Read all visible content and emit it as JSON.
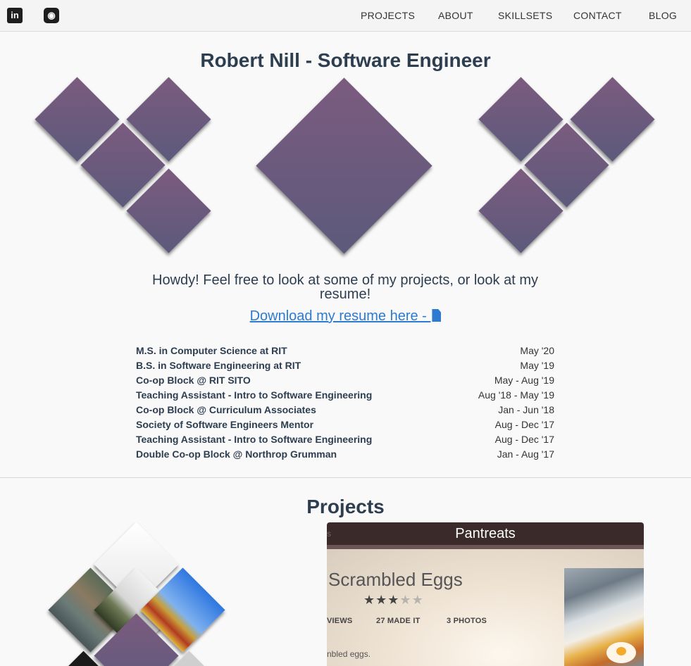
{
  "nav": {
    "social": [
      {
        "name": "linkedin",
        "glyph": "in"
      },
      {
        "name": "github",
        "glyph": "◉"
      }
    ],
    "links": [
      "PROJECTS",
      "ABOUT",
      "SKILLSETS",
      "CONTACT",
      "BLOG"
    ]
  },
  "header": {
    "title": "Robert Nill - Software Engineer",
    "intro": "Howdy! Feel free to look at some of my projects, or look at my resume!",
    "resume_link": "Download my resume here - "
  },
  "timeline": [
    {
      "name": "M.S. in Computer Science at RIT",
      "date": "May '20"
    },
    {
      "name": "B.S. in Software Engineering at RIT",
      "date": "May '19"
    },
    {
      "name": "Co-op Block @ RIT SITO",
      "date": "May - Aug '19"
    },
    {
      "name": "Teaching Assistant - Intro to Software Engineering",
      "date": "Aug '18 - May '19"
    },
    {
      "name": "Co-op Block @ Curriculum Associates",
      "date": "Jan - Jun '18"
    },
    {
      "name": "Society of Software Engineers Mentor",
      "date": "Aug - Dec '17"
    },
    {
      "name": "Teaching Assistant - Intro to Software Engineering",
      "date": "Aug - Dec '17"
    },
    {
      "name": "Double Co-op Block @ Northrop Grumman",
      "date": "Jan - Aug '17"
    }
  ],
  "projects": {
    "heading": "Projects",
    "card": {
      "app_title": "Pantreats",
      "ghost_tab": "s",
      "recipe_title": "Scrambled Eggs",
      "rating": 3,
      "rating_max": 5,
      "stats": [
        "VIEWS",
        "27 MADE IT",
        "3 PHOTOS"
      ],
      "description": "nbled eggs."
    }
  },
  "colors": {
    "diamond_start": "#7b5b7e",
    "diamond_end": "#5c5a7c",
    "link": "#2c7bd1",
    "heading": "#2d3e50"
  }
}
